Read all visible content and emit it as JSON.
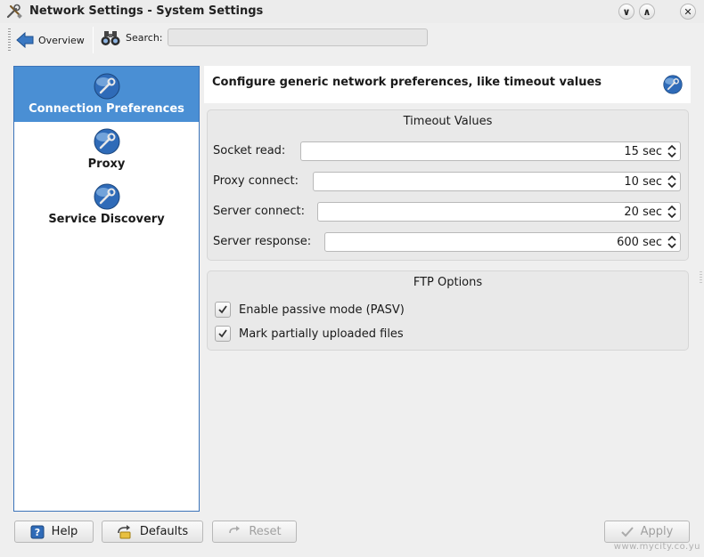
{
  "window": {
    "title": "Network Settings - System Settings",
    "buttons": {
      "minimize": "∨",
      "maximize": "∧",
      "close": "✕"
    }
  },
  "toolbar": {
    "overview_label": "Overview",
    "search_label": "Search:",
    "search_value": ""
  },
  "sidebar": {
    "items": [
      {
        "label": "Connection Preferences",
        "icon": "network-globe-icon",
        "selected": true
      },
      {
        "label": "Proxy",
        "icon": "network-globe-icon",
        "selected": false
      },
      {
        "label": "Service Discovery",
        "icon": "network-globe-icon",
        "selected": false
      }
    ]
  },
  "header": {
    "text": "Configure generic network preferences, like timeout values",
    "icon": "network-globe-icon"
  },
  "timeout": {
    "title": "Timeout Values",
    "rows": [
      {
        "label": "Socket read:",
        "value": "15 sec"
      },
      {
        "label": "Proxy connect:",
        "value": "10 sec"
      },
      {
        "label": "Server connect:",
        "value": "20 sec"
      },
      {
        "label": "Server response:",
        "value": "600 sec"
      }
    ]
  },
  "ftp": {
    "title": "FTP Options",
    "options": [
      {
        "label": "Enable passive mode (PASV)",
        "checked": true
      },
      {
        "label": "Mark partially uploaded files",
        "checked": true
      }
    ]
  },
  "footer": {
    "help": "Help",
    "defaults": "Defaults",
    "reset": "Reset",
    "apply": "Apply"
  },
  "watermark": "www.mycity.co.yu",
  "colors": {
    "selection": "#4a8fd4",
    "sidebar_border": "#3b73b9",
    "background": "#efefef"
  }
}
